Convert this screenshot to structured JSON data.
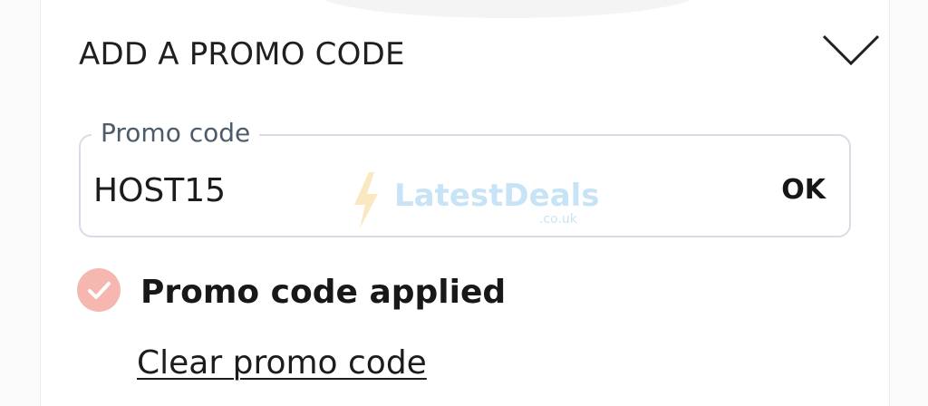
{
  "promo": {
    "accordion_title": "ADD A PROMO CODE",
    "chevron_icon": "chevron-down-icon",
    "field_label": "Promo code",
    "field_value": "HOST15",
    "ok_label": "OK",
    "status_icon": "check-circle-icon",
    "status_text": "Promo code applied",
    "clear_label": "Clear promo code"
  },
  "watermark": {
    "brand": "LatestDeals",
    "domain": ".co.uk"
  },
  "colors": {
    "check_badge": "#f5b7b0",
    "field_border": "#d6dde6",
    "watermark": "#62b3e8"
  }
}
